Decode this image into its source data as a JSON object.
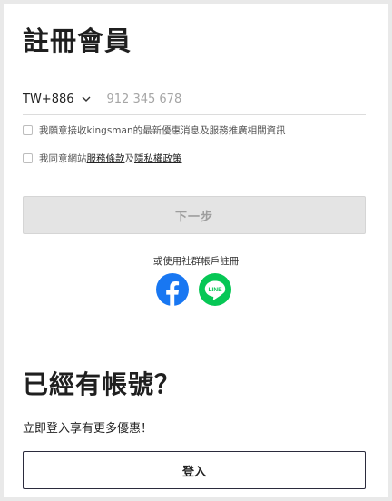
{
  "page": {
    "title": "註冊會員"
  },
  "phone": {
    "country_code": "TW+886",
    "placeholder": "912 345 678",
    "value": ""
  },
  "consents": [
    {
      "text": "我願意接收kingsman的最新優惠消息及服務推廣相關資訊",
      "checked": false
    },
    {
      "prefix": "我同意網站",
      "terms_link": "服務條款",
      "joiner": "及",
      "privacy_link": "隱私權政策",
      "checked": false
    }
  ],
  "next_button": {
    "label": "下一步",
    "enabled": false
  },
  "social": {
    "label": "或使用社群帳戶註冊",
    "line_text": "LINE",
    "colors": {
      "facebook": "#1877f2",
      "line": "#06c755"
    }
  },
  "login_section": {
    "heading": "已經有帳號？",
    "subtitle": "立即登入享有更多優惠！",
    "button_label": "登入"
  }
}
